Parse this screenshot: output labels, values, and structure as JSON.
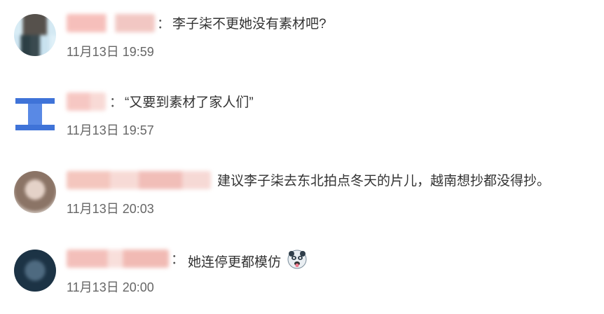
{
  "comments": [
    {
      "separator": "：",
      "text": "李子柒不更她没有素材吧?",
      "time": "11月13日 19:59",
      "avatar_icon": "user-avatar",
      "emoji": null
    },
    {
      "separator": "：",
      "text": "“又要到素材了家人们”",
      "time": "11月13日 19:57",
      "avatar_icon": "user-avatar",
      "emoji": null
    },
    {
      "separator": "",
      "text": "建议李子柒去东北拍点冬天的片儿，越南想抄都没得抄。",
      "time": "11月13日 20:03",
      "avatar_icon": "user-avatar",
      "emoji": null
    },
    {
      "separator": "：",
      "text": "她连停更都模仿",
      "time": "11月13日 20:00",
      "avatar_icon": "user-avatar",
      "emoji": "panda-tongue-emoji"
    }
  ]
}
